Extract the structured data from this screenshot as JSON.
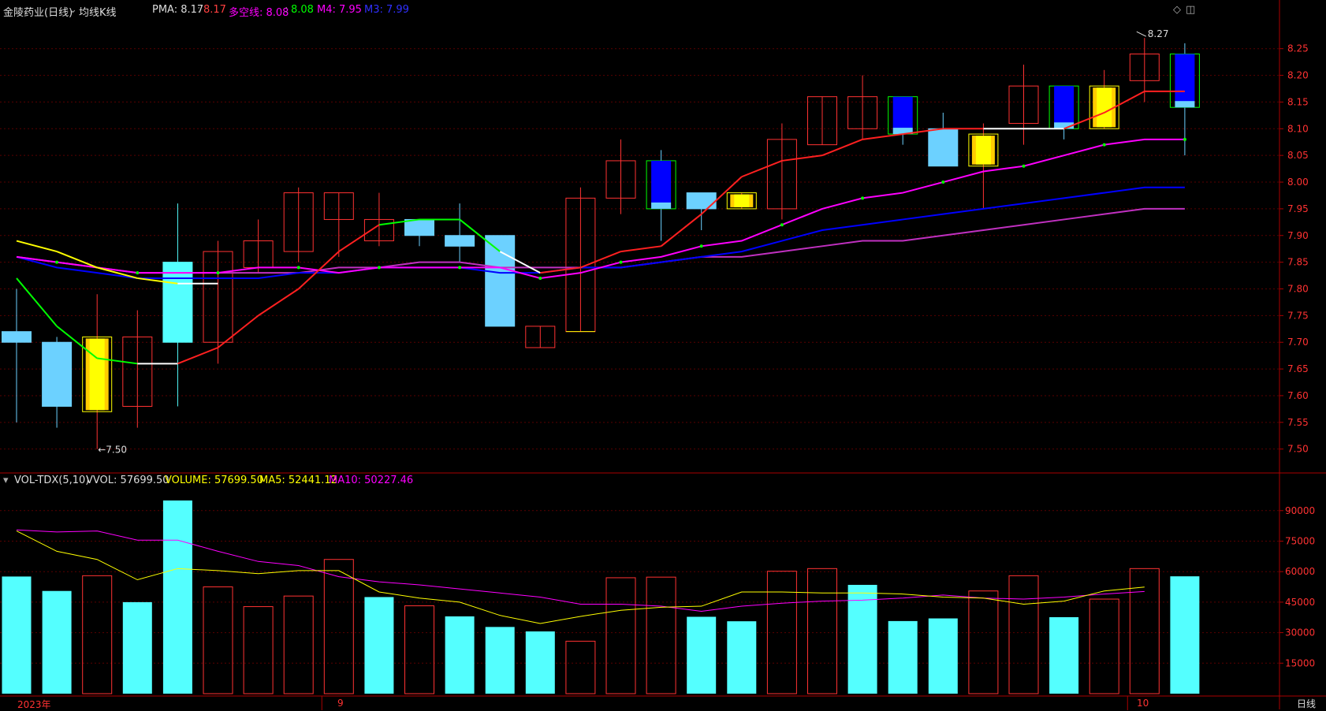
{
  "header": {
    "stock_name": "金陵药业(日线)",
    "indicator_name": "均线K线",
    "pma_label": "PMA: 8.17",
    "pma_value": "8.17",
    "duokong_label": "多空线: 8.08",
    "duokong_value": "8.08",
    "m4_label": "M4: 7.95",
    "m3_label": "M3: 7.99"
  },
  "volume_header": {
    "indicator": "VOL-TDX(5,10)",
    "vvol": "VVOL: 57699.50",
    "volume": "VOLUME: 57699.50",
    "ma5": "MA5: 52441.12",
    "ma10": "MA10: 50227.46"
  },
  "price_axis": [
    "8.25",
    "8.20",
    "8.15",
    "8.10",
    "8.05",
    "8.00",
    "7.95",
    "7.90",
    "7.85",
    "7.80",
    "7.75",
    "7.70",
    "7.65",
    "7.60",
    "7.55",
    "7.50"
  ],
  "volume_axis": [
    "90000",
    "75000",
    "60000",
    "45000",
    "30000",
    "15000"
  ],
  "date_labels": {
    "start": "2023年",
    "sep": "9",
    "oct": "10"
  },
  "period_label": "日线",
  "annotations": {
    "high": "8.27",
    "low": "7.50"
  },
  "colors": {
    "up": "#ff3232",
    "down": "#54ffff",
    "red_line": "#ff2020",
    "magenta": "#ff00ff",
    "blue": "#0000ff",
    "yellow": "#ffff00",
    "green": "#00ff00",
    "pink_ma10": "#ff00ff",
    "grid": "#7a0000"
  },
  "chart_data": {
    "type": "candlestick",
    "candles": [
      {
        "open": 7.72,
        "close": 7.7,
        "high": 7.8,
        "low": 7.55,
        "style": "down_light"
      },
      {
        "open": 7.7,
        "close": 7.58,
        "high": 7.71,
        "low": 7.54,
        "style": "down_light"
      },
      {
        "open": 7.57,
        "close": 7.71,
        "high": 7.79,
        "low": 7.5,
        "style": "yellow"
      },
      {
        "open": 7.58,
        "close": 7.71,
        "high": 7.76,
        "low": 7.54,
        "style": "up"
      },
      {
        "open": 7.85,
        "close": 7.7,
        "high": 7.96,
        "low": 7.58,
        "style": "down_cyan"
      },
      {
        "open": 7.7,
        "close": 7.87,
        "high": 7.89,
        "low": 7.66,
        "style": "up"
      },
      {
        "open": 7.84,
        "close": 7.89,
        "high": 7.93,
        "low": 7.83,
        "style": "up"
      },
      {
        "open": 7.87,
        "close": 7.98,
        "high": 7.99,
        "low": 7.85,
        "style": "up"
      },
      {
        "open": 7.93,
        "close": 7.98,
        "high": 7.98,
        "low": 7.86,
        "style": "up"
      },
      {
        "open": 7.89,
        "close": 7.93,
        "high": 7.98,
        "low": 7.88,
        "style": "up"
      },
      {
        "open": 7.93,
        "close": 7.9,
        "high": 7.93,
        "low": 7.88,
        "style": "down_light"
      },
      {
        "open": 7.9,
        "close": 7.88,
        "high": 7.96,
        "low": 7.85,
        "style": "down_light"
      },
      {
        "open": 7.9,
        "close": 7.73,
        "high": 7.9,
        "low": 7.73,
        "style": "down_light"
      },
      {
        "open": 7.69,
        "close": 7.73,
        "high": 7.73,
        "low": 7.69,
        "style": "up"
      },
      {
        "open": 7.72,
        "close": 7.97,
        "high": 7.99,
        "low": 7.72,
        "style": "up_dash"
      },
      {
        "open": 7.97,
        "close": 8.04,
        "high": 8.08,
        "low": 7.94,
        "style": "up"
      },
      {
        "open": 8.04,
        "close": 7.95,
        "high": 8.06,
        "low": 7.89,
        "style": "down_blue"
      },
      {
        "open": 7.98,
        "close": 7.95,
        "high": 7.98,
        "low": 7.91,
        "style": "down_light"
      },
      {
        "open": 7.95,
        "close": 7.98,
        "high": 7.98,
        "low": 7.95,
        "style": "yellow"
      },
      {
        "open": 7.95,
        "close": 8.08,
        "high": 8.11,
        "low": 7.93,
        "style": "up"
      },
      {
        "open": 8.07,
        "close": 8.16,
        "high": 8.16,
        "low": 8.07,
        "style": "up"
      },
      {
        "open": 8.1,
        "close": 8.16,
        "high": 8.2,
        "low": 8.08,
        "style": "up"
      },
      {
        "open": 8.16,
        "close": 8.09,
        "high": 8.16,
        "low": 8.07,
        "style": "down_blue"
      },
      {
        "open": 8.1,
        "close": 8.03,
        "high": 8.13,
        "low": 8.03,
        "style": "down_light"
      },
      {
        "open": 8.03,
        "close": 8.09,
        "high": 8.11,
        "low": 7.95,
        "style": "yellow"
      },
      {
        "open": 8.11,
        "close": 8.18,
        "high": 8.22,
        "low": 8.07,
        "style": "up"
      },
      {
        "open": 8.18,
        "close": 8.1,
        "high": 8.18,
        "low": 8.08,
        "style": "down_blue"
      },
      {
        "open": 8.1,
        "close": 8.18,
        "high": 8.21,
        "low": 8.1,
        "style": "yellow"
      },
      {
        "open": 8.19,
        "close": 8.24,
        "high": 8.27,
        "low": 8.15,
        "style": "up"
      },
      {
        "open": 8.24,
        "close": 8.14,
        "high": 8.26,
        "low": 8.05,
        "style": "down_blue"
      }
    ],
    "pma_line": [
      {
        "i": 0,
        "v": 7.89,
        "c": "#ffff00"
      },
      {
        "i": 1,
        "v": 7.87,
        "c": "#ffff00"
      },
      {
        "i": 2,
        "v": 7.84,
        "c": "#ffff00"
      },
      {
        "i": 3,
        "v": 7.82,
        "c": "#ffff00"
      },
      {
        "i": 4,
        "v": 7.81,
        "c": "#ffff00"
      },
      {
        "i": 5,
        "v": 7.81,
        "c": "#ffffff"
      }
    ],
    "fast_line": [
      7.82,
      7.73,
      7.67,
      7.66,
      7.66,
      7.69,
      7.75,
      7.8,
      7.87,
      7.92,
      7.93,
      7.93,
      7.87,
      7.83,
      7.84,
      7.87,
      7.88,
      7.94,
      8.01,
      8.04,
      8.05,
      8.08,
      8.09,
      8.1,
      8.1,
      8.1,
      8.1,
      8.13,
      8.17,
      8.17
    ],
    "fast_line_colors": [
      "#00ff00",
      "#00ff00",
      "#00ff00",
      "#00ff00",
      "#ffffff",
      "#ff2020",
      "#ff2020",
      "#ff2020",
      "#ff2020",
      "#ff2020",
      "#00ff00",
      "#00ff00",
      "#00ff00",
      "#ffffff",
      "#ff2020",
      "#ff2020",
      "#ff2020",
      "#ff2020",
      "#ff2020",
      "#ff2020",
      "#ff2020",
      "#ff2020",
      "#ff2020",
      "#ff2020",
      "#ff2020",
      "#ffffff",
      "#ffffff",
      "#ff2020",
      "#ff2020",
      "#ff2020"
    ],
    "duokong_line": [
      7.86,
      7.85,
      7.84,
      7.83,
      7.83,
      7.83,
      7.84,
      7.84,
      7.83,
      7.84,
      7.84,
      7.84,
      7.84,
      7.82,
      7.83,
      7.85,
      7.86,
      7.88,
      7.89,
      7.92,
      7.95,
      7.97,
      7.98,
      8.0,
      8.02,
      8.03,
      8.05,
      8.07,
      8.08,
      8.08
    ],
    "m3_line": [
      7.86,
      7.84,
      7.83,
      7.82,
      7.82,
      7.82,
      7.82,
      7.83,
      7.83,
      7.84,
      7.84,
      7.84,
      7.83,
      7.83,
      7.84,
      7.84,
      7.85,
      7.86,
      7.87,
      7.89,
      7.91,
      7.92,
      7.93,
      7.94,
      7.95,
      7.96,
      7.97,
      7.98,
      7.99,
      7.99
    ],
    "m4_line": [
      7.86,
      7.85,
      7.84,
      7.83,
      7.83,
      7.83,
      7.83,
      7.83,
      7.84,
      7.84,
      7.85,
      7.85,
      7.84,
      7.84,
      7.84,
      7.84,
      7.85,
      7.86,
      7.86,
      7.87,
      7.88,
      7.89,
      7.89,
      7.9,
      7.91,
      7.92,
      7.93,
      7.94,
      7.95,
      7.95
    ],
    "volumes": [
      57600,
      50500,
      58000,
      45000,
      95000,
      52500,
      42800,
      48000,
      66000,
      47500,
      43200,
      38000,
      32800,
      30600,
      25800,
      57000,
      57300,
      37800,
      35600,
      60200,
      61500,
      53500,
      35700,
      37000,
      50500,
      58000,
      37600,
      46500,
      61500,
      57700
    ],
    "vol_up": [
      false,
      false,
      true,
      false,
      false,
      true,
      true,
      true,
      true,
      false,
      true,
      false,
      false,
      false,
      true,
      true,
      true,
      false,
      false,
      true,
      true,
      false,
      false,
      false,
      true,
      true,
      false,
      true,
      true,
      false
    ],
    "vol_ma5": [
      80000,
      70000,
      66000,
      56000,
      61500,
      60500,
      59000,
      60500,
      60500,
      50000,
      47000,
      45000,
      38500,
      34500,
      38000,
      41000,
      42500,
      43000,
      50000,
      50000,
      49500,
      49500,
      49000,
      47500,
      47000,
      44000,
      45500,
      50500,
      52441
    ],
    "vol_ma10": [
      80500,
      79500,
      80000,
      75500,
      75500,
      70000,
      65000,
      63000,
      57500,
      55000,
      53500,
      51500,
      49500,
      47500,
      44000,
      44000,
      43000,
      40500,
      43000,
      44500,
      45500,
      46000,
      47000,
      48500,
      47000,
      46500,
      47500,
      49000,
      50227
    ],
    "price_range": [
      7.47,
      8.285
    ],
    "volume_range": [
      0,
      100000
    ]
  }
}
